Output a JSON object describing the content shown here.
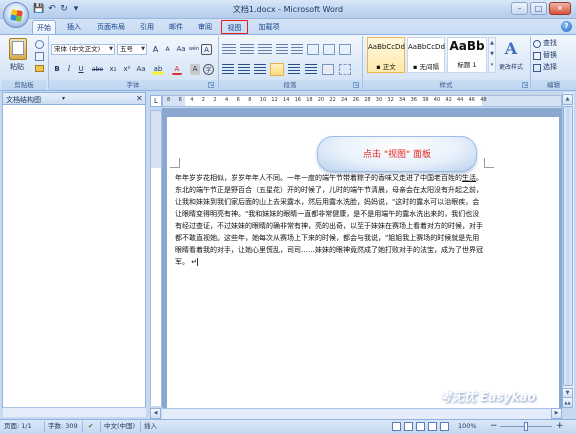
{
  "title_bar": {
    "title": "文档1.docx - Microsoft Word",
    "minimize": "–",
    "maximize": "□",
    "close": "✕",
    "qat_save": "💾",
    "qat_undo": "↶",
    "qat_redo": "↻",
    "qat_more": "▾"
  },
  "tabs": {
    "home": "开始",
    "insert": "插入",
    "page_layout": "页面布局",
    "references": "引用",
    "mailings": "邮件",
    "review": "审阅",
    "view": "视图",
    "addins": "加载项",
    "help": "?"
  },
  "ribbon": {
    "clipboard": {
      "paste": "粘贴",
      "label": "剪贴板"
    },
    "font": {
      "font_name": "宋体 (中文正文)",
      "font_size": "五号",
      "grow": "A",
      "shrink": "A",
      "clear": "Aa",
      "phonetic": "wén",
      "charborder": "A",
      "bold": "B",
      "italic": "I",
      "underline": "U",
      "strike": "abe",
      "subscript": "x₂",
      "superscript": "x²",
      "case": "Aa",
      "highlight": "ab",
      "font_color": "A",
      "charshade": "A",
      "encircle": "字",
      "label": "字体"
    },
    "paragraph": {
      "label": "段落"
    },
    "styles": {
      "s1_sample": "AaBbCcDd",
      "s1_name": "▪ 正文",
      "s2_sample": "AaBbCcDd",
      "s2_name": "▪ 无间隔",
      "s3_sample": "AaBb",
      "s3_name": "标题 1",
      "change": "更改样式",
      "label": "样式"
    },
    "editing": {
      "find": "查找",
      "replace": "替换",
      "select": "选择",
      "label": "编辑"
    }
  },
  "nav_pane": {
    "title": "文档结构图",
    "dropdown": "▾",
    "close": "✕"
  },
  "ruler": {
    "corner": "L",
    "numbers": [
      "8",
      "6",
      "4",
      "2",
      "2",
      "4",
      "6",
      "8",
      "10",
      "12",
      "14",
      "16",
      "18",
      "20",
      "22",
      "24",
      "26",
      "28",
      "30",
      "32",
      "34",
      "36",
      "38",
      "40",
      "42",
      "44",
      "46",
      "48"
    ]
  },
  "callout": {
    "text": "点击 \"视图\" 面板"
  },
  "document": {
    "p1_start": "年年岁岁花相似，岁岁年年人不同。一年一度的端午节带着粽子的香味又走进了中国老百姓的",
    "p1_link": "生活",
    "p1_rest": "。东北的端午节正是野百合（五星花）开的时候了，儿时的端午节清晨，母亲会在太阳没有升起之前，让我和妹妹到我们家后面的山上去采露水，然后用露水洗脸，妈妈说，\"这时的露水可以治眼疾，会让眼睛变得明亮有神。\"我和妹妹的眼睛一直都非常健康，是不是用端午的露水洗出来的，我们也没有经过查证，不过妹妹的眼睛的确非常有神，亮的出奇，以至于妹妹在赛场上看着对方的时候，对手都不敢直视她。这些年，她每次从赛场上下来的时候，都会与我说，\"姐姐我上赛场的时候就是先用眼睛看着我的对手，让她心里慌乱，司司……妹妹的眼神竟然成了她打败对手的法宝，成为了世界冠军。",
    "para_mark": "↵"
  },
  "status": {
    "page": "页面: 1/1",
    "words": "字数: 309",
    "proof": "✔",
    "lang": "中文(中国)",
    "insert": "插入",
    "zoom": "100%",
    "zoom_minus": "−",
    "zoom_plus": "+"
  },
  "watermark": "考无忧 Easykao"
}
